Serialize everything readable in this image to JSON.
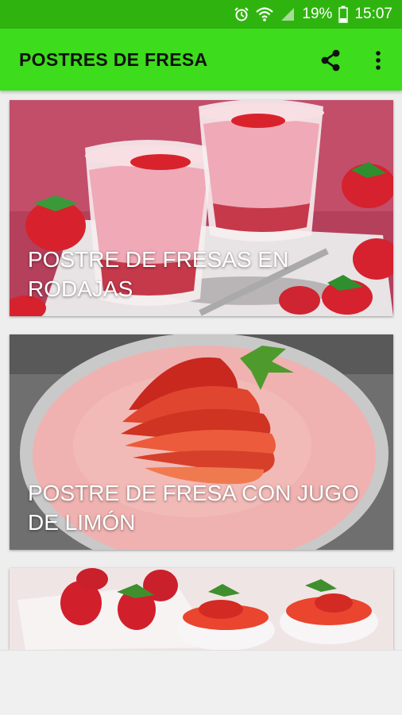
{
  "status_bar": {
    "battery_percent": "19%",
    "time": "15:07",
    "icons": [
      "alarm-icon",
      "wifi-icon",
      "signal-icon",
      "battery-icon"
    ]
  },
  "app_bar": {
    "title": "POSTRES DE FRESA",
    "actions": [
      "share-icon",
      "more-vert-icon"
    ],
    "background_color": "#3ddc1c"
  },
  "recipes": [
    {
      "title": "POSTRE DE FRESAS EN RODAJAS"
    },
    {
      "title": "POSTRE DE FRESA CON JUGO DE LIMÓN"
    },
    {
      "title": ""
    }
  ]
}
